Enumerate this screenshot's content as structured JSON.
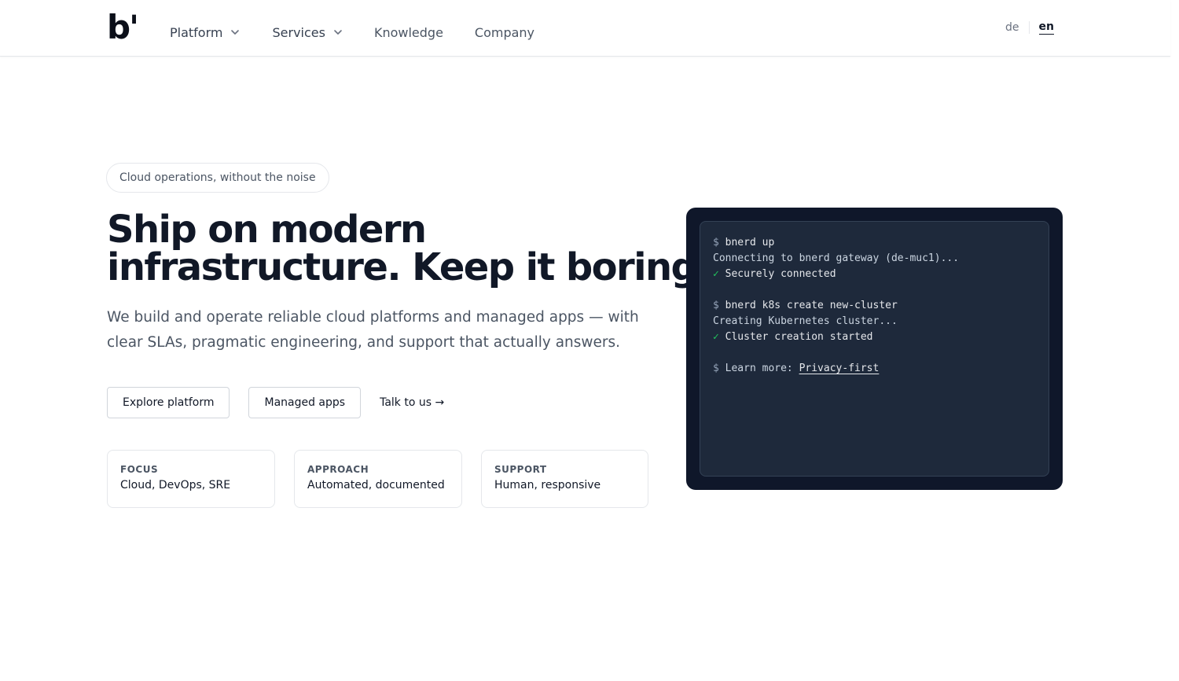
{
  "brand": {
    "logo_text": "b'"
  },
  "nav": {
    "items": [
      {
        "label": "Platform",
        "dropdown": true
      },
      {
        "label": "Services",
        "dropdown": true
      },
      {
        "label": "Knowledge",
        "dropdown": false
      },
      {
        "label": "Company",
        "dropdown": false
      }
    ]
  },
  "language": {
    "options": [
      "de",
      "en"
    ],
    "active": "en"
  },
  "hero": {
    "eyebrow": "Cloud operations, without the noise",
    "headline_line1": "Ship on modern",
    "headline_line2": "infrastructure. Keep it boring.",
    "lead": "We build and operate reliable cloud platforms and managed apps — with clear SLAs, pragmatic engineering, and support that actually answers.",
    "actions": {
      "primary": "Explore platform",
      "secondary": "Managed apps",
      "link": "Talk to us →"
    },
    "cards": [
      {
        "key": "FOCUS",
        "value": "Cloud, DevOps, SRE"
      },
      {
        "key": "APPROACH",
        "value": "Automated, documented"
      },
      {
        "key": "SUPPORT",
        "value": "Human, responsive"
      }
    ]
  },
  "terminal": {
    "prompt": "$",
    "check": "✓",
    "cmd1": "bnerd up",
    "out1": "Connecting to bnerd gateway (de-muc1)...",
    "ok1": "Securely connected",
    "cmd2": "bnerd k8s create new-cluster",
    "out2": "Creating Kubernetes cluster...",
    "ok2": "Cluster creation started",
    "learn_prefix": "Learn more:",
    "learn_link": "Privacy-first"
  },
  "colors": {
    "text": "#111827",
    "muted": "#4b5563",
    "terminal_bg": "#0f172a",
    "terminal_panel": "#1e293b",
    "success": "#22c55e"
  }
}
